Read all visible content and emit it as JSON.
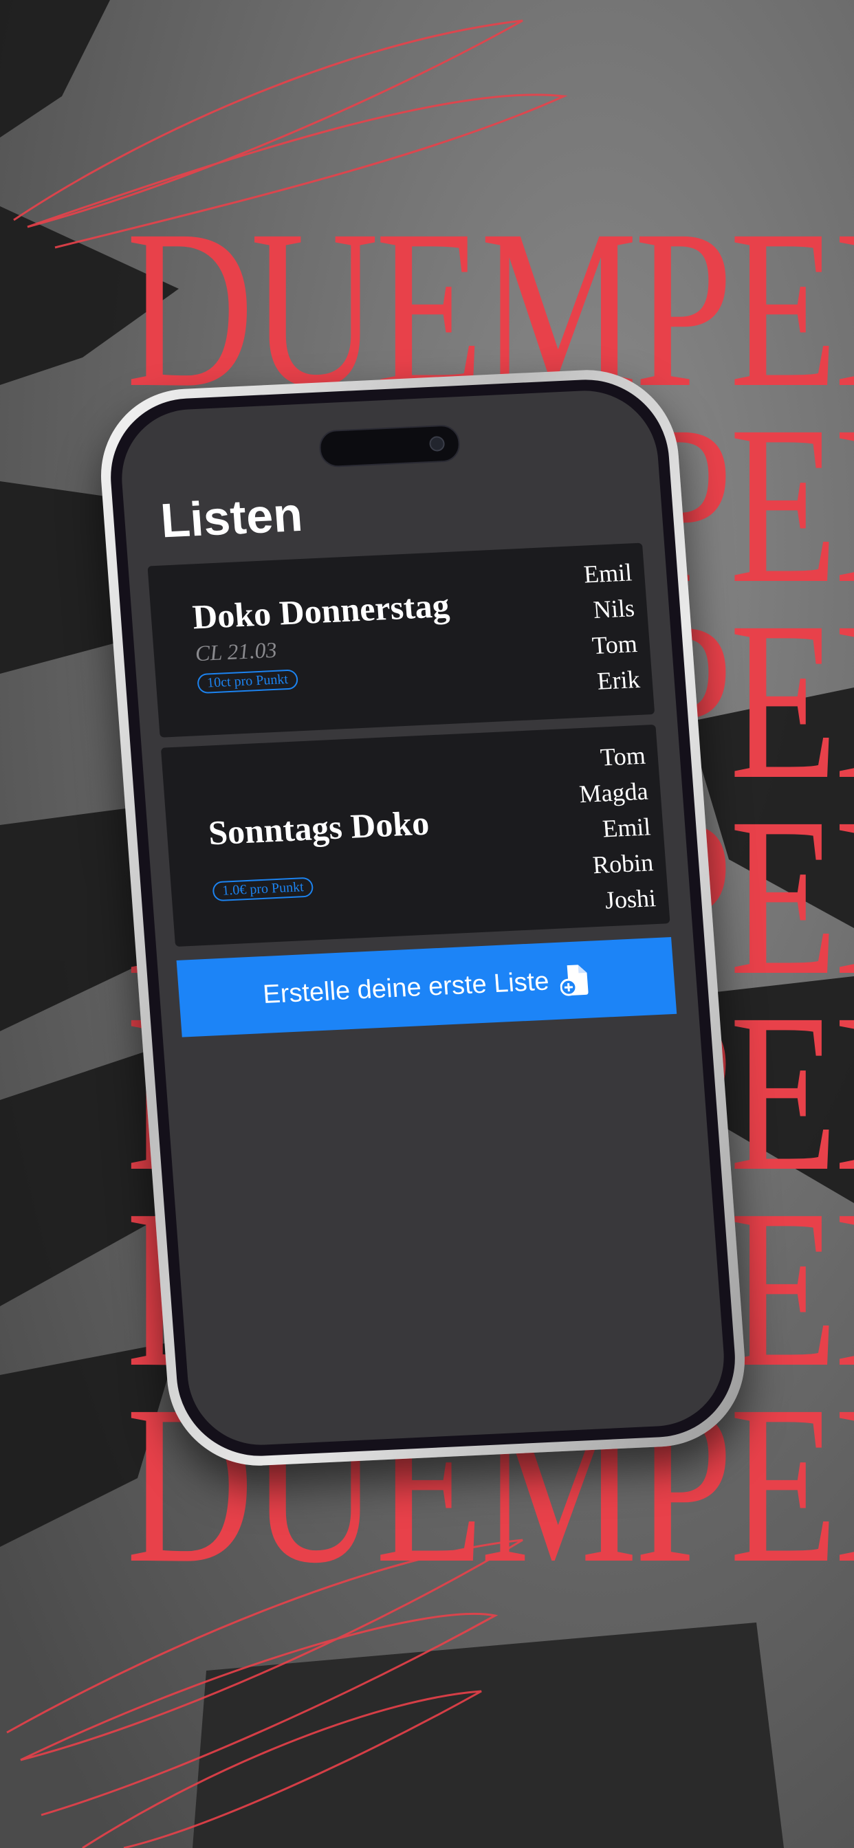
{
  "backdrop": {
    "word": "DUEMPEL",
    "accent_color": "#e8414a"
  },
  "screen": {
    "title": "Listen",
    "lists": [
      {
        "name": "Doko Donnerstag",
        "subtitle": "CL 21.03",
        "rate": "10ct pro Punkt",
        "players": [
          "Emil",
          "Nils",
          "Tom",
          "Erik"
        ]
      },
      {
        "name": "Sonntags Doko",
        "rate": "1.0€ pro Punkt",
        "players": [
          "Tom",
          "Magda",
          "Emil",
          "Robin",
          "Joshi"
        ]
      }
    ],
    "create_button": {
      "label": "Erstelle deine erste Liste",
      "icon": "document-add-icon",
      "color": "#1c84f7"
    }
  }
}
